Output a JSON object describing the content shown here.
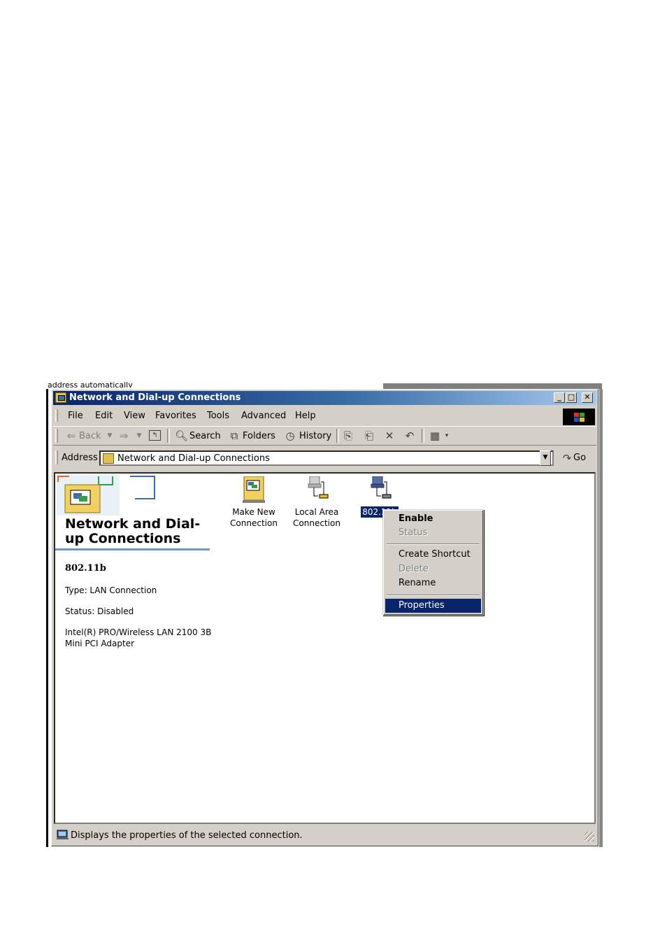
{
  "background": {
    "partial_text": "address automatically"
  },
  "window": {
    "title": "Network and Dial-up Connections",
    "controls": {
      "minimize": "_",
      "maximize": "□",
      "close": "✕"
    }
  },
  "menubar": {
    "items": [
      "File",
      "Edit",
      "View",
      "Favorites",
      "Tools",
      "Advanced",
      "Help"
    ]
  },
  "toolbar": {
    "back": "Back",
    "search": "Search",
    "folders": "Folders",
    "history": "History"
  },
  "address": {
    "label": "Address",
    "value": "Network and Dial-up Connections",
    "go": "Go"
  },
  "left_panel": {
    "title": "Network and Dial-up Connections",
    "connection_name": "802.11b",
    "type": "Type: LAN Connection",
    "status": "Status: Disabled",
    "adapter_line1": "Intel(R) PRO/Wireless LAN 2100 3B",
    "adapter_line2": "Mini PCI Adapter"
  },
  "items": [
    {
      "label_line1": "Make New",
      "label_line2": "Connection"
    },
    {
      "label_line1": "Local Area",
      "label_line2": "Connection"
    },
    {
      "label_line1": "802.11b",
      "selected": true
    }
  ],
  "context_menu": {
    "items": [
      {
        "label": "Enable",
        "default": true,
        "enabled": true
      },
      {
        "label": "Status",
        "enabled": false
      },
      {
        "label": "Create Shortcut",
        "enabled": true
      },
      {
        "label": "Delete",
        "enabled": false
      },
      {
        "label": "Rename",
        "enabled": true
      },
      {
        "label": "Properties",
        "enabled": true,
        "highlighted": true
      }
    ]
  },
  "statusbar": {
    "text": "Displays the properties of the selected connection."
  },
  "colors": {
    "title_active": "#0a246a",
    "selection": "#0a246a",
    "face": "#d4d0c8",
    "panel_rule": "#6a96c8"
  }
}
